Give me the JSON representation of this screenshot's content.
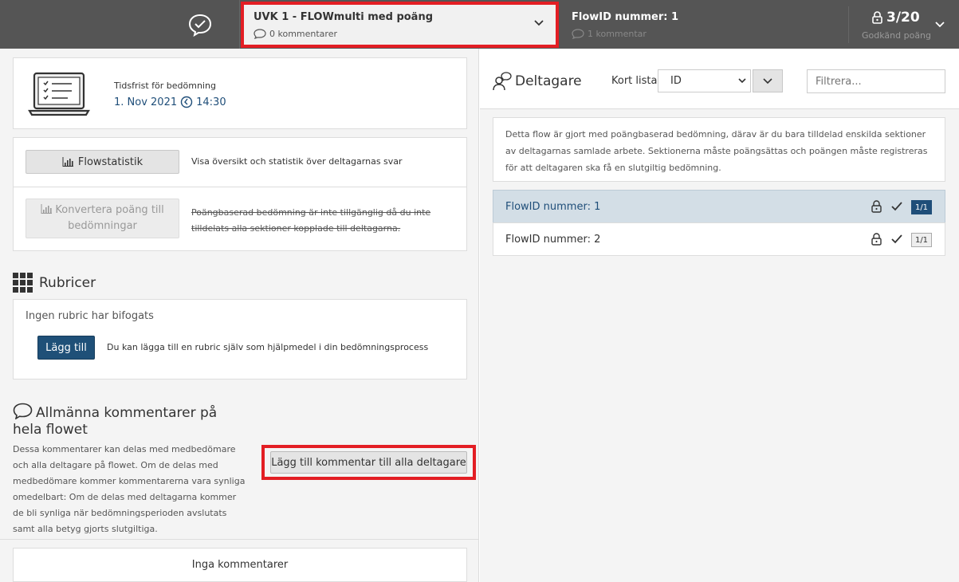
{
  "topbar": {
    "flow_title": "UVK 1 - FLOWmulti med poäng",
    "flow_comments": "0 kommentarer",
    "current_flowid": "FlowID nummer: 1",
    "current_comments": "1 kommentar",
    "score": "3/20",
    "score_label": "Godkänd poäng"
  },
  "left": {
    "deadline_label": "Tidsfrist för bedömning",
    "deadline_date": "1. Nov 2021",
    "deadline_time": "14:30",
    "flowstat_button": "Flowstatistik",
    "flowstat_desc": "Visa översikt och statistik över deltagarnas svar",
    "convert_button": "Konvertera poäng till bedömningar",
    "convert_desc": "Poängbaserad bedömning är inte tillgänglig då du inte tilldelats alla sektioner kopplade till deltagarna.",
    "rubric_heading": "Rubricer",
    "rubric_none": "Ingen rubric har bifogats",
    "rubric_add_button": "Lägg till",
    "rubric_add_desc": "Du kan lägga till en rubric själv som hjälpmedel i din bedömningsprocess",
    "comments_heading": "Allmänna kommentarer på hela flowet",
    "comments_desc": "Dessa kommentarer kan delas med medbedömare och alla deltagare på flowet. Om de delas med medbedömare kommer kommentarerna vara synliga omedelbart: Om de delas med deltagarna kommer de bli synliga när bedömningsperioden avslutats samt alla betyg gjorts slutgiltiga.",
    "add_comment_button": "Lägg till kommentar till alla deltagare",
    "no_comments": "Inga kommentarer"
  },
  "right": {
    "title": "Deltagare",
    "sort_label": "Kort lista",
    "sort_value": "ID",
    "filter_placeholder": "Filtrera...",
    "info_text": "Detta flow är gjort med poängbaserad bedömning, därav är du bara tilldelad enskilda sektioner av deltagarnas samlade arbete. Sektionerna måste poängsättas och poängen måste registreras för att deltagaren ska få en slutgiltig bedömning.",
    "participants": [
      {
        "name": "FlowID nummer: 1",
        "badge": "1/1"
      },
      {
        "name": "FlowID nummer: 2",
        "badge": "1/1"
      }
    ]
  },
  "colors": {
    "topbar": "#555555",
    "accent_blue": "#1f5078",
    "highlight_red": "#e31e24",
    "active_row": "#d3dee6"
  }
}
